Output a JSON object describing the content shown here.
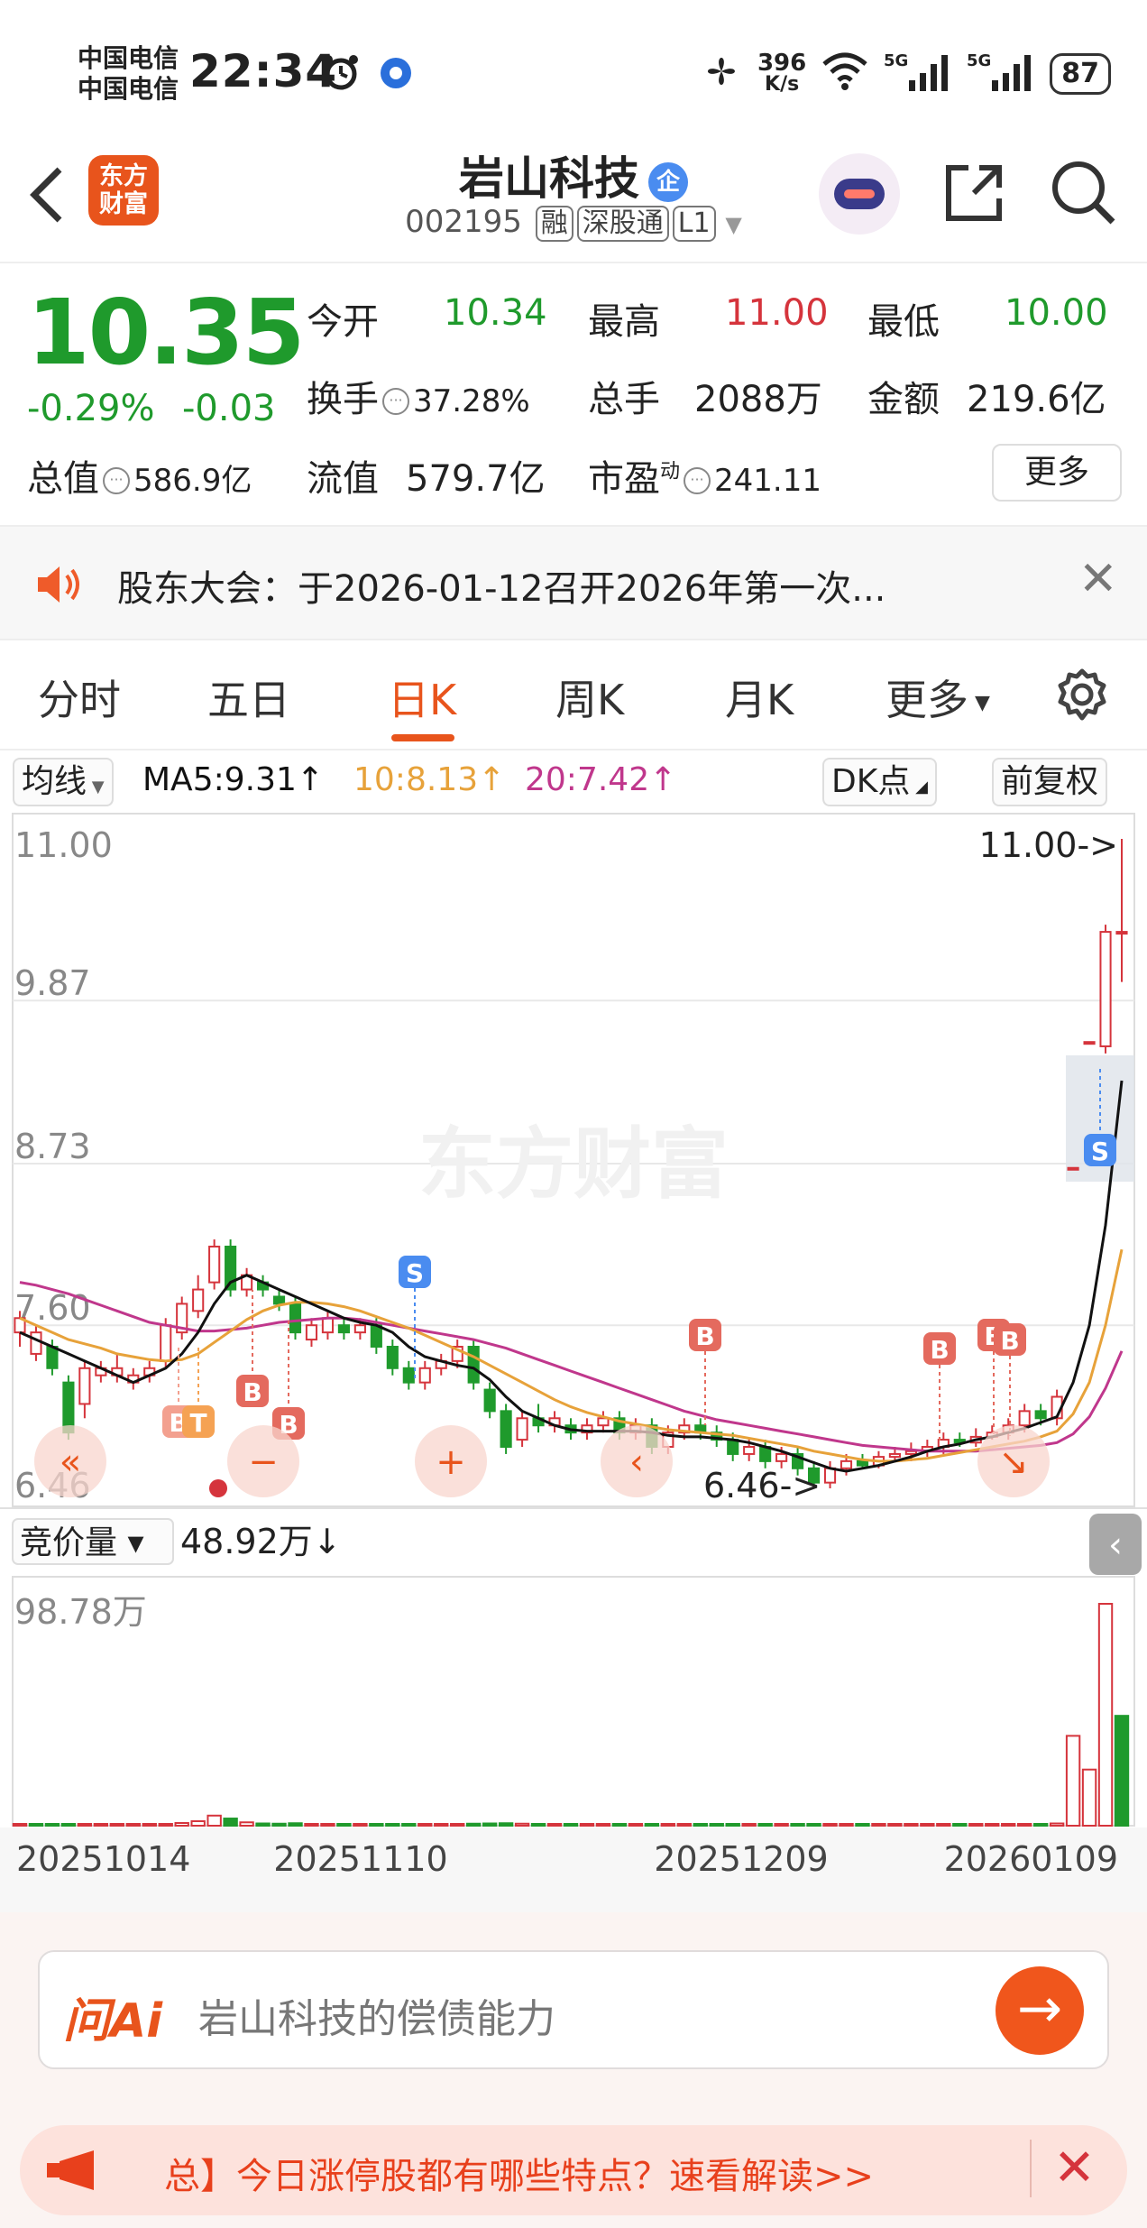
{
  "status_bar": {
    "carrier_line1": "中国电信",
    "carrier_line2": "中国电信",
    "time": "22:34",
    "net_speed_value": "396",
    "net_speed_unit": "K/s",
    "battery": "87"
  },
  "header": {
    "logo_text_line1": "东方",
    "logo_text_line2": "财富",
    "stock_name": "岩山科技",
    "enterprise_badge": "企",
    "stock_code": "002195",
    "tags": [
      "融",
      "深股通",
      "L1"
    ]
  },
  "quote": {
    "price": "10.35",
    "change_pct": "-0.29%",
    "change": "-0.03",
    "fields": {
      "open_label": "今开",
      "open": "10.34",
      "high_label": "最高",
      "high": "11.00",
      "low_label": "最低",
      "low": "10.00",
      "turnover_label": "换手",
      "turnover": "37.28%",
      "volume_label": "总手",
      "volume": "2088万",
      "amount_label": "金额",
      "amount": "219.6亿",
      "mcap_label": "总值",
      "mcap": "586.9亿",
      "float_label": "流值",
      "float_cap": "579.7亿",
      "pe_label": "市盈",
      "pe_sup": "动",
      "pe": "241.11"
    },
    "more_label": "更多"
  },
  "notice": {
    "text": "股东大会：于2026-01-12召开2026年第一次..."
  },
  "tabs": [
    "分时",
    "五日",
    "日K",
    "周K",
    "月K",
    "更多"
  ],
  "active_tab": "日K",
  "ma_bar": {
    "ma_select": "均线",
    "ma5": "MA5:9.31↑",
    "ma10": "10:8.13↑",
    "ma20": "20:7.42↑",
    "dk_label": "DK点",
    "fq_label": "前复权"
  },
  "chart_labels": {
    "watermark": "东方财富",
    "max_price_marker": "11.00->",
    "min_price_marker": "6.46->",
    "auction_select": "竞价量",
    "auction_value": "48.92万↓",
    "volume_max": "98.78万",
    "signals": {
      "buy": "B",
      "sell": "S",
      "t": "T"
    },
    "control_icons": [
      "«",
      "−",
      "+",
      "‹",
      "↘"
    ]
  },
  "colors": {
    "up": "#d5343c",
    "down": "#1f9a2c",
    "accent": "#e8541c",
    "ma5": "#111111",
    "ma10": "#e7a23a",
    "ma20": "#c0378c"
  },
  "chart_data": {
    "type": "candlestick",
    "y_axis_ticks": [
      "11.00",
      "9.87",
      "8.73",
      "7.60",
      "6.46"
    ],
    "ylim": [
      6.46,
      11.0
    ],
    "x_axis_ticks": [
      "20251014",
      "20251110",
      "20251209",
      "20260109"
    ],
    "volume_ylim": [
      0,
      98.78
    ],
    "candles": [
      {
        "o": 7.55,
        "c": 7.65,
        "h": 7.7,
        "l": 7.45
      },
      {
        "o": 7.4,
        "c": 7.55,
        "h": 7.6,
        "l": 7.35
      },
      {
        "o": 7.45,
        "c": 7.3,
        "h": 7.5,
        "l": 7.25
      },
      {
        "o": 7.2,
        "c": 6.85,
        "h": 7.25,
        "l": 6.8
      },
      {
        "o": 7.05,
        "c": 7.3,
        "h": 7.35,
        "l": 6.95
      },
      {
        "o": 7.25,
        "c": 7.3,
        "h": 7.35,
        "l": 7.2
      },
      {
        "o": 7.25,
        "c": 7.3,
        "h": 7.4,
        "l": 7.2
      },
      {
        "o": 7.2,
        "c": 7.25,
        "h": 7.3,
        "l": 7.15
      },
      {
        "o": 7.25,
        "c": 7.3,
        "h": 7.35,
        "l": 7.2
      },
      {
        "o": 7.35,
        "c": 7.6,
        "h": 7.65,
        "l": 7.3
      },
      {
        "o": 7.55,
        "c": 7.75,
        "h": 7.8,
        "l": 7.5
      },
      {
        "o": 7.7,
        "c": 7.85,
        "h": 7.95,
        "l": 7.65
      },
      {
        "o": 7.9,
        "c": 8.15,
        "h": 8.2,
        "l": 7.85
      },
      {
        "o": 8.15,
        "c": 7.85,
        "h": 8.2,
        "l": 7.8
      },
      {
        "o": 7.85,
        "c": 7.95,
        "h": 8.0,
        "l": 7.8
      },
      {
        "o": 7.9,
        "c": 7.85,
        "h": 7.95,
        "l": 7.8
      },
      {
        "o": 7.8,
        "c": 7.75,
        "h": 7.85,
        "l": 7.7
      },
      {
        "o": 7.75,
        "c": 7.55,
        "h": 7.8,
        "l": 7.5
      },
      {
        "o": 7.5,
        "c": 7.6,
        "h": 7.65,
        "l": 7.45
      },
      {
        "o": 7.55,
        "c": 7.65,
        "h": 7.7,
        "l": 7.5
      },
      {
        "o": 7.6,
        "c": 7.55,
        "h": 7.65,
        "l": 7.5
      },
      {
        "o": 7.55,
        "c": 7.6,
        "h": 7.65,
        "l": 7.5
      },
      {
        "o": 7.6,
        "c": 7.45,
        "h": 7.65,
        "l": 7.4
      },
      {
        "o": 7.45,
        "c": 7.3,
        "h": 7.5,
        "l": 7.25
      },
      {
        "o": 7.3,
        "c": 7.2,
        "h": 7.35,
        "l": 7.15
      },
      {
        "o": 7.2,
        "c": 7.3,
        "h": 7.35,
        "l": 7.15
      },
      {
        "o": 7.3,
        "c": 7.35,
        "h": 7.4,
        "l": 7.25
      },
      {
        "o": 7.35,
        "c": 7.45,
        "h": 7.5,
        "l": 7.3
      },
      {
        "o": 7.45,
        "c": 7.2,
        "h": 7.5,
        "l": 7.15
      },
      {
        "o": 7.15,
        "c": 7.0,
        "h": 7.2,
        "l": 6.95
      },
      {
        "o": 7.0,
        "c": 6.75,
        "h": 7.05,
        "l": 6.7
      },
      {
        "o": 6.8,
        "c": 6.95,
        "h": 7.0,
        "l": 6.75
      },
      {
        "o": 6.95,
        "c": 6.9,
        "h": 7.05,
        "l": 6.85
      },
      {
        "o": 6.9,
        "c": 6.95,
        "h": 7.0,
        "l": 6.85
      },
      {
        "o": 6.9,
        "c": 6.85,
        "h": 6.95,
        "l": 6.8
      },
      {
        "o": 6.85,
        "c": 6.9,
        "h": 6.95,
        "l": 6.8
      },
      {
        "o": 6.9,
        "c": 6.95,
        "h": 7.0,
        "l": 6.85
      },
      {
        "o": 6.95,
        "c": 6.85,
        "h": 7.0,
        "l": 6.8
      },
      {
        "o": 6.85,
        "c": 6.9,
        "h": 6.95,
        "l": 6.8
      },
      {
        "o": 6.9,
        "c": 6.75,
        "h": 6.95,
        "l": 6.7
      },
      {
        "o": 6.75,
        "c": 6.85,
        "h": 6.9,
        "l": 6.7
      },
      {
        "o": 6.85,
        "c": 6.9,
        "h": 6.95,
        "l": 6.8
      },
      {
        "o": 6.9,
        "c": 6.85,
        "h": 6.95,
        "l": 6.8
      },
      {
        "o": 6.85,
        "c": 6.8,
        "h": 6.9,
        "l": 6.75
      },
      {
        "o": 6.8,
        "c": 6.7,
        "h": 6.85,
        "l": 6.65
      },
      {
        "o": 6.7,
        "c": 6.75,
        "h": 6.8,
        "l": 6.65
      },
      {
        "o": 6.75,
        "c": 6.65,
        "h": 6.8,
        "l": 6.6
      },
      {
        "o": 6.65,
        "c": 6.7,
        "h": 6.75,
        "l": 6.6
      },
      {
        "o": 6.7,
        "c": 6.6,
        "h": 6.75,
        "l": 6.55
      },
      {
        "o": 6.6,
        "c": 6.5,
        "h": 6.65,
        "l": 6.46
      },
      {
        "o": 6.5,
        "c": 6.6,
        "h": 6.65,
        "l": 6.46
      },
      {
        "o": 6.6,
        "c": 6.65,
        "h": 6.7,
        "l": 6.55
      },
      {
        "o": 6.65,
        "c": 6.62,
        "h": 6.7,
        "l": 6.6
      },
      {
        "o": 6.62,
        "c": 6.68,
        "h": 6.72,
        "l": 6.6
      },
      {
        "o": 6.68,
        "c": 6.7,
        "h": 6.75,
        "l": 6.65
      },
      {
        "o": 6.7,
        "c": 6.72,
        "h": 6.78,
        "l": 6.65
      },
      {
        "o": 6.72,
        "c": 6.75,
        "h": 6.8,
        "l": 6.68
      },
      {
        "o": 6.75,
        "c": 6.8,
        "h": 6.85,
        "l": 6.7
      },
      {
        "o": 6.8,
        "c": 6.78,
        "h": 6.85,
        "l": 6.75
      },
      {
        "o": 6.78,
        "c": 6.82,
        "h": 6.88,
        "l": 6.75
      },
      {
        "o": 6.82,
        "c": 6.85,
        "h": 6.9,
        "l": 6.8
      },
      {
        "o": 6.85,
        "c": 6.9,
        "h": 6.95,
        "l": 6.8
      },
      {
        "o": 6.9,
        "c": 7.0,
        "h": 7.05,
        "l": 6.85
      },
      {
        "o": 7.0,
        "c": 6.95,
        "h": 7.05,
        "l": 6.9
      },
      {
        "o": 6.95,
        "c": 7.1,
        "h": 7.15,
        "l": 6.9
      },
      {
        "o": 8.7,
        "c": 8.7,
        "h": 8.7,
        "l": 8.7
      },
      {
        "o": 9.58,
        "c": 9.58,
        "h": 9.58,
        "l": 9.58
      },
      {
        "o": 9.55,
        "c": 10.35,
        "h": 10.4,
        "l": 9.5
      },
      {
        "o": 10.34,
        "c": 10.35,
        "h": 11.0,
        "l": 10.0
      }
    ],
    "volumes": [
      {
        "v": 0.6,
        "up": true
      },
      {
        "v": 0.5,
        "up": false
      },
      {
        "v": 0.5,
        "up": false
      },
      {
        "v": 0.7,
        "up": false
      },
      {
        "v": 0.6,
        "up": true
      },
      {
        "v": 0.4,
        "up": true
      },
      {
        "v": 0.4,
        "up": true
      },
      {
        "v": 0.3,
        "up": true
      },
      {
        "v": 0.4,
        "up": true
      },
      {
        "v": 0.8,
        "up": true
      },
      {
        "v": 1.2,
        "up": true
      },
      {
        "v": 2.0,
        "up": true
      },
      {
        "v": 4.5,
        "up": true
      },
      {
        "v": 3.2,
        "up": false
      },
      {
        "v": 1.5,
        "up": true
      },
      {
        "v": 1.0,
        "up": false
      },
      {
        "v": 0.9,
        "up": false
      },
      {
        "v": 1.1,
        "up": false
      },
      {
        "v": 0.8,
        "up": true
      },
      {
        "v": 0.7,
        "up": true
      },
      {
        "v": 0.6,
        "up": false
      },
      {
        "v": 0.6,
        "up": true
      },
      {
        "v": 0.8,
        "up": false
      },
      {
        "v": 0.7,
        "up": false
      },
      {
        "v": 0.6,
        "up": false
      },
      {
        "v": 0.6,
        "up": true
      },
      {
        "v": 0.7,
        "up": true
      },
      {
        "v": 0.8,
        "up": true
      },
      {
        "v": 0.9,
        "up": false
      },
      {
        "v": 1.0,
        "up": false
      },
      {
        "v": 1.1,
        "up": false
      },
      {
        "v": 0.9,
        "up": true
      },
      {
        "v": 0.7,
        "up": false
      },
      {
        "v": 0.6,
        "up": true
      },
      {
        "v": 0.6,
        "up": false
      },
      {
        "v": 0.5,
        "up": true
      },
      {
        "v": 0.5,
        "up": true
      },
      {
        "v": 0.5,
        "up": false
      },
      {
        "v": 0.5,
        "up": true
      },
      {
        "v": 0.7,
        "up": false
      },
      {
        "v": 0.6,
        "up": true
      },
      {
        "v": 0.5,
        "up": true
      },
      {
        "v": 0.5,
        "up": false
      },
      {
        "v": 0.5,
        "up": false
      },
      {
        "v": 0.6,
        "up": false
      },
      {
        "v": 0.5,
        "up": true
      },
      {
        "v": 0.5,
        "up": false
      },
      {
        "v": 0.4,
        "up": true
      },
      {
        "v": 0.5,
        "up": false
      },
      {
        "v": 0.7,
        "up": false
      },
      {
        "v": 0.6,
        "up": true
      },
      {
        "v": 0.5,
        "up": true
      },
      {
        "v": 0.4,
        "up": false
      },
      {
        "v": 0.4,
        "up": true
      },
      {
        "v": 0.4,
        "up": true
      },
      {
        "v": 0.4,
        "up": true
      },
      {
        "v": 0.5,
        "up": true
      },
      {
        "v": 0.5,
        "up": true
      },
      {
        "v": 0.4,
        "up": false
      },
      {
        "v": 0.5,
        "up": true
      },
      {
        "v": 0.5,
        "up": true
      },
      {
        "v": 0.6,
        "up": true
      },
      {
        "v": 0.8,
        "up": true
      },
      {
        "v": 0.7,
        "up": false
      },
      {
        "v": 1.0,
        "up": true
      },
      {
        "v": 40.0,
        "up": true
      },
      {
        "v": 25.0,
        "up": true
      },
      {
        "v": 98.78,
        "up": true
      },
      {
        "v": 48.92,
        "up": false
      }
    ],
    "ma5": [
      7.55,
      7.5,
      7.45,
      7.4,
      7.35,
      7.3,
      7.25,
      7.2,
      7.25,
      7.3,
      7.4,
      7.55,
      7.75,
      7.9,
      7.95,
      7.9,
      7.85,
      7.8,
      7.75,
      7.7,
      7.65,
      7.62,
      7.6,
      7.55,
      7.45,
      7.38,
      7.35,
      7.32,
      7.3,
      7.22,
      7.1,
      7.0,
      6.95,
      6.9,
      6.87,
      6.86,
      6.86,
      6.86,
      6.86,
      6.85,
      6.83,
      6.82,
      6.82,
      6.81,
      6.8,
      6.78,
      6.75,
      6.72,
      6.68,
      6.64,
      6.6,
      6.58,
      6.6,
      6.62,
      6.65,
      6.68,
      6.72,
      6.75,
      6.77,
      6.8,
      6.82,
      6.85,
      6.88,
      6.92,
      6.96,
      7.2,
      7.6,
      8.3,
      9.31
    ],
    "ma10": [
      7.65,
      7.6,
      7.55,
      7.5,
      7.47,
      7.44,
      7.4,
      7.38,
      7.36,
      7.35,
      7.36,
      7.4,
      7.48,
      7.56,
      7.64,
      7.7,
      7.74,
      7.76,
      7.76,
      7.75,
      7.73,
      7.7,
      7.66,
      7.62,
      7.58,
      7.53,
      7.48,
      7.43,
      7.38,
      7.32,
      7.26,
      7.2,
      7.14,
      7.08,
      7.03,
      6.99,
      6.96,
      6.93,
      6.91,
      6.89,
      6.87,
      6.86,
      6.85,
      6.84,
      6.83,
      6.81,
      6.79,
      6.77,
      6.75,
      6.72,
      6.7,
      6.68,
      6.66,
      6.65,
      6.65,
      6.66,
      6.67,
      6.69,
      6.71,
      6.73,
      6.75,
      6.77,
      6.79,
      6.82,
      6.86,
      6.98,
      7.2,
      7.6,
      8.13
    ],
    "ma20": [
      7.9,
      7.88,
      7.85,
      7.82,
      7.78,
      7.74,
      7.7,
      7.66,
      7.62,
      7.6,
      7.58,
      7.56,
      7.56,
      7.57,
      7.58,
      7.6,
      7.62,
      7.63,
      7.64,
      7.65,
      7.65,
      7.64,
      7.62,
      7.6,
      7.58,
      7.56,
      7.54,
      7.52,
      7.5,
      7.47,
      7.44,
      7.4,
      7.36,
      7.32,
      7.28,
      7.24,
      7.2,
      7.16,
      7.12,
      7.08,
      7.04,
      7.0,
      6.97,
      6.94,
      6.92,
      6.9,
      6.88,
      6.86,
      6.84,
      6.82,
      6.8,
      6.78,
      6.76,
      6.75,
      6.74,
      6.73,
      6.72,
      6.72,
      6.72,
      6.72,
      6.73,
      6.74,
      6.75,
      6.76,
      6.78,
      6.84,
      6.96,
      7.16,
      7.42
    ]
  },
  "ai_bar": {
    "logo": "问Ai",
    "query": "岩山科技的偿债能力",
    "go": "→"
  },
  "promo": {
    "text": "总】今日涨停股都有哪些特点？速看解读>>"
  }
}
